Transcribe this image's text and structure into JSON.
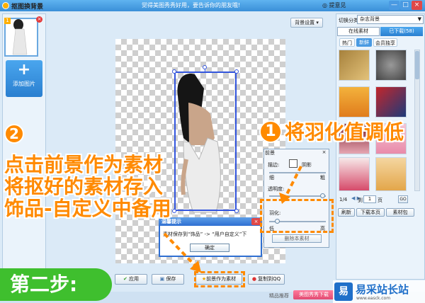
{
  "window": {
    "title": "抠图换背景",
    "slogan": "觉得美图秀秀好用，要告诉你的朋友哦!",
    "help": "◎ 提意见",
    "minimize": "—",
    "maximize": "□",
    "close": "×"
  },
  "left_panel": {
    "thumb_number": "1",
    "thumb_close": "×",
    "add_plus": "+",
    "add_label": "添加图片"
  },
  "canvas": {
    "bg_settings": "背景设置 ▾"
  },
  "right_panel": {
    "switch_label": "切换分类",
    "category": "杂志背景",
    "tab_online": "在线素材",
    "tab_downloaded": "已下载(58)",
    "subtabs": [
      "热门",
      "新鲜",
      "会员独享"
    ],
    "pager_text": "1/4",
    "pager_to": "到",
    "pager_page": "页",
    "page_input": "1",
    "go": "GO",
    "refresh": "刷新",
    "download_page": "下载本页",
    "material_pack": "素材包"
  },
  "fg_dialog": {
    "title": "前景",
    "close": "×",
    "edge_label": "描边:",
    "shadow_label": "阴影",
    "thin": "细",
    "thick": "粗",
    "opacity": "透明度:",
    "feather": "羽化:",
    "low": "低",
    "high": "高",
    "delete": "删除本素材"
  },
  "tip_dialog": {
    "title": "温馨提示",
    "close": "×",
    "message": "素材保存到“饰品” -> “用户自定义”下",
    "ok": "确定"
  },
  "bottom_bar": {
    "apply": "应用",
    "save": "保存",
    "fg_as_material": "前景作为素材",
    "copy_qq": "复制到QQ",
    "fav": "精品推荐",
    "meitu": "美图秀秀下载"
  },
  "annotations": {
    "circle_two": "2",
    "circle_one": "1",
    "note_left": [
      "点击前景作为素材",
      "将抠好的素材存入",
      "饰品-自定义中备用"
    ],
    "note_right": "将羽化值调低",
    "step": "第二步:"
  },
  "watermark": {
    "logo": "易",
    "text": "易采站长站",
    "url": "www.easck.com"
  },
  "colors": {
    "accent_orange": "#ff8a00",
    "step_green": "#3fbf2e",
    "selection_blue": "#3355dd"
  }
}
